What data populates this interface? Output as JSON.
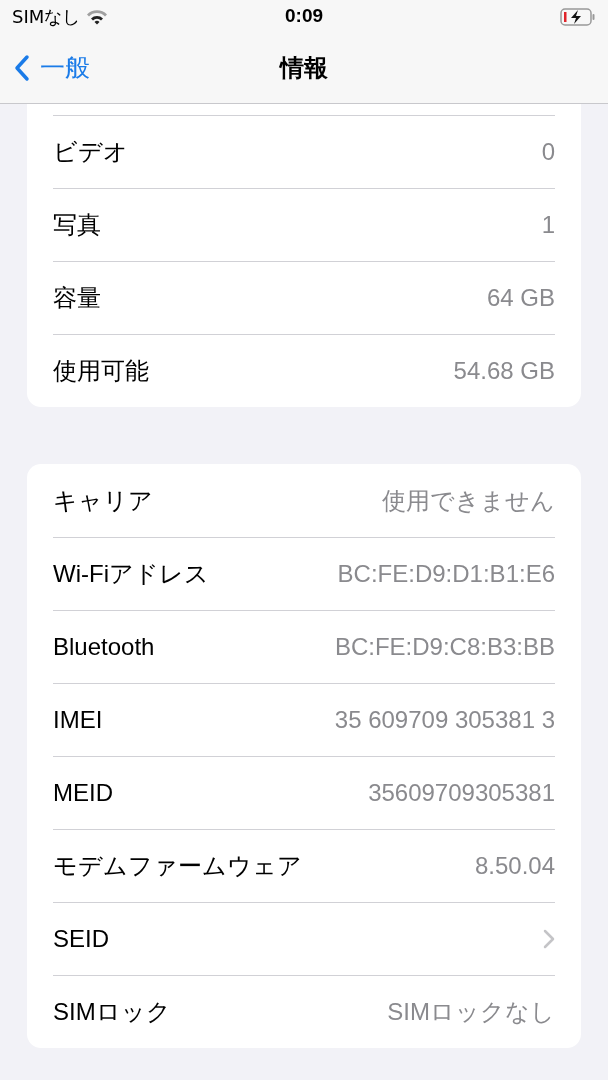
{
  "status_bar": {
    "carrier": "SIMなし",
    "time": "0:09"
  },
  "nav": {
    "back": "一般",
    "title": "情報"
  },
  "groups": [
    {
      "rows": [
        {
          "kind": "value",
          "label": "ビデオ",
          "value": "0"
        },
        {
          "kind": "value",
          "label": "写真",
          "value": "1"
        },
        {
          "kind": "value",
          "label": "容量",
          "value": "64 GB"
        },
        {
          "kind": "value",
          "label": "使用可能",
          "value": "54.68 GB"
        }
      ]
    },
    {
      "rows": [
        {
          "kind": "value",
          "label": "キャリア",
          "value": "使用できません"
        },
        {
          "kind": "value",
          "label": "Wi-Fiアドレス",
          "value": "BC:FE:D9:D1:B1:E6"
        },
        {
          "kind": "value",
          "label": "Bluetooth",
          "value": "BC:FE:D9:C8:B3:BB"
        },
        {
          "kind": "value",
          "label": "IMEI",
          "value": "35 609709 305381 3"
        },
        {
          "kind": "value",
          "label": "MEID",
          "value": "35609709305381"
        },
        {
          "kind": "value",
          "label": "モデムファームウェア",
          "value": "8.50.04"
        },
        {
          "kind": "link",
          "label": "SEID"
        },
        {
          "kind": "value",
          "label": "SIMロック",
          "value": "SIMロックなし"
        }
      ]
    }
  ]
}
